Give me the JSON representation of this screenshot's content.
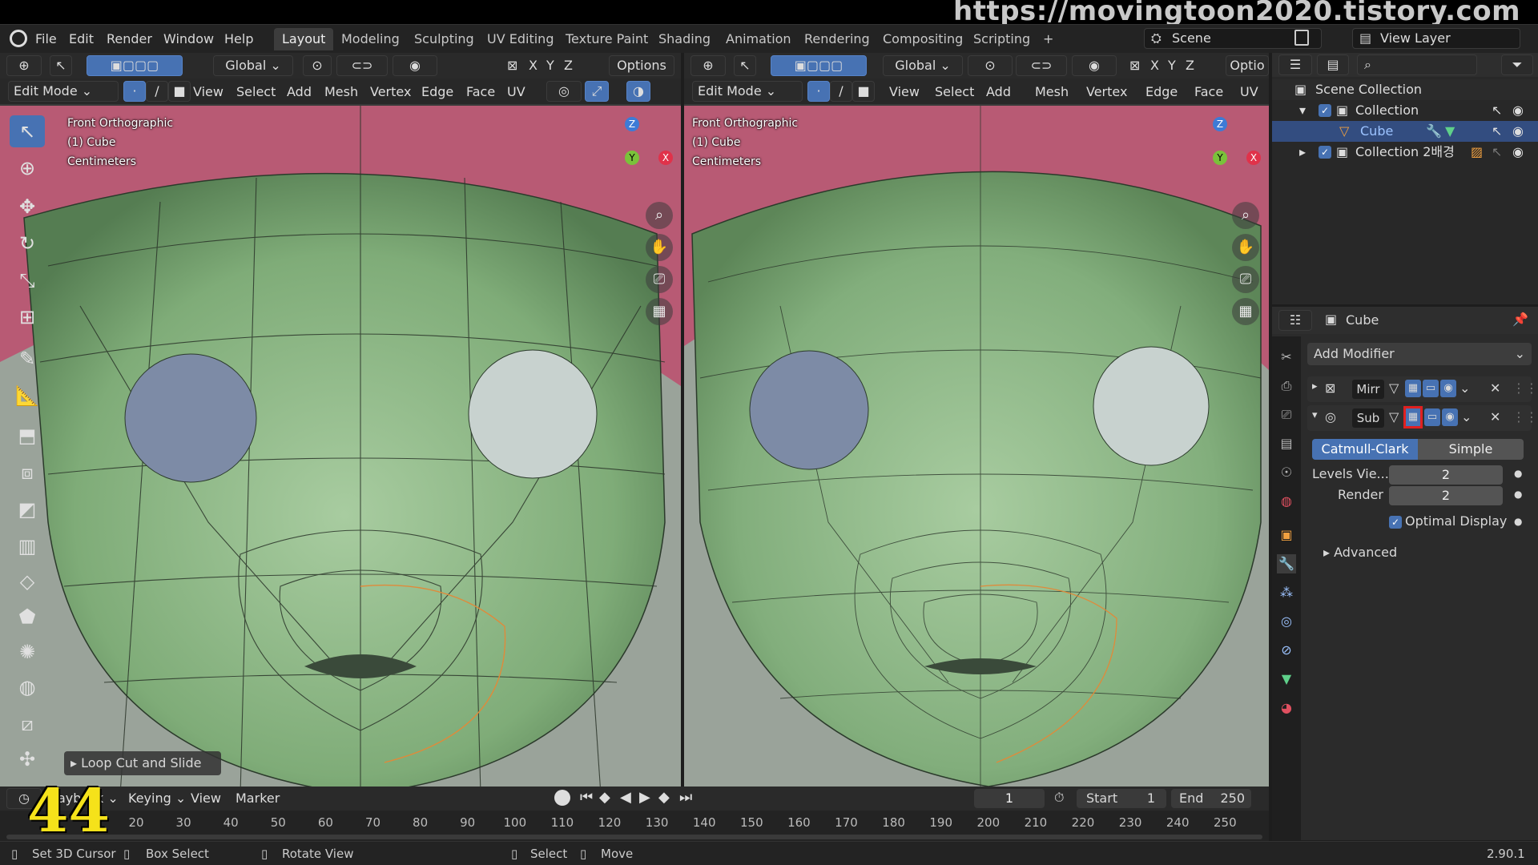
{
  "watermark": "https://movingtoon2020.tistory.com",
  "menu": [
    "File",
    "Edit",
    "Render",
    "Window",
    "Help"
  ],
  "workspaces": [
    "Layout",
    "Modeling",
    "Sculpting",
    "UV Editing",
    "Texture Paint",
    "Shading",
    "Animation",
    "Rendering",
    "Compositing",
    "Scripting",
    "+"
  ],
  "scene": {
    "label": "Scene",
    "view_layer": "View Layer"
  },
  "viewport_left": {
    "orientation": "Global",
    "options": "Options",
    "mode": "Edit Mode",
    "menus": [
      "View",
      "Select",
      "Add",
      "Mesh",
      "Vertex",
      "Edge",
      "Face",
      "UV"
    ],
    "info": [
      "Front Orthographic",
      "(1) Cube",
      "Centimeters"
    ],
    "axes": [
      "Z",
      "Y",
      "X"
    ],
    "last_op": "Loop Cut and Slide"
  },
  "viewport_right": {
    "orientation": "Global",
    "options": "Optio",
    "mode": "Edit Mode",
    "menus": [
      "View",
      "Select",
      "Add",
      "Mesh",
      "Vertex",
      "Edge",
      "Face",
      "UV"
    ],
    "info": [
      "Front Orthographic",
      "(1) Cube",
      "Centimeters"
    ],
    "axes": [
      "Z",
      "Y",
      "X"
    ]
  },
  "xyz": [
    "X",
    "Y",
    "Z"
  ],
  "outliner": {
    "root": "Scene Collection",
    "items": [
      {
        "label": "Collection"
      },
      {
        "label": "Cube"
      },
      {
        "label": "Collection 2배경"
      }
    ]
  },
  "properties": {
    "object_name": "Cube",
    "add_modifier": "Add Modifier",
    "modifiers": [
      {
        "name": "Mirr"
      },
      {
        "name": "Sub"
      }
    ],
    "subdiv_types": [
      "Catmull-Clark",
      "Simple"
    ],
    "levels_label": "Levels Vie...",
    "levels_value": "2",
    "render_label": "Render",
    "render_value": "2",
    "optimal_display": "Optimal Display",
    "advanced": "Advanced"
  },
  "timeline": {
    "playback": "ayback",
    "keying": "Keying",
    "view": "View",
    "marker": "Marker",
    "current_frame": "1",
    "start_label": "Start",
    "start_value": "1",
    "end_label": "End",
    "end_value": "250",
    "ticks": [
      "20",
      "30",
      "40",
      "50",
      "60",
      "70",
      "80",
      "90",
      "100",
      "110",
      "120",
      "130",
      "140",
      "150",
      "160",
      "170",
      "180",
      "190",
      "200",
      "210",
      "220",
      "230",
      "240",
      "250"
    ],
    "overlay_number": "44"
  },
  "status": {
    "items": [
      "Set 3D Cursor",
      "Box Select",
      "Rotate View",
      "Select",
      "Move"
    ],
    "version": "2.90.1"
  },
  "colors": {
    "accent": "#4772b3",
    "highlight_box": "#e02020",
    "face_green": "#8fba86",
    "hair": "#b85a74"
  }
}
